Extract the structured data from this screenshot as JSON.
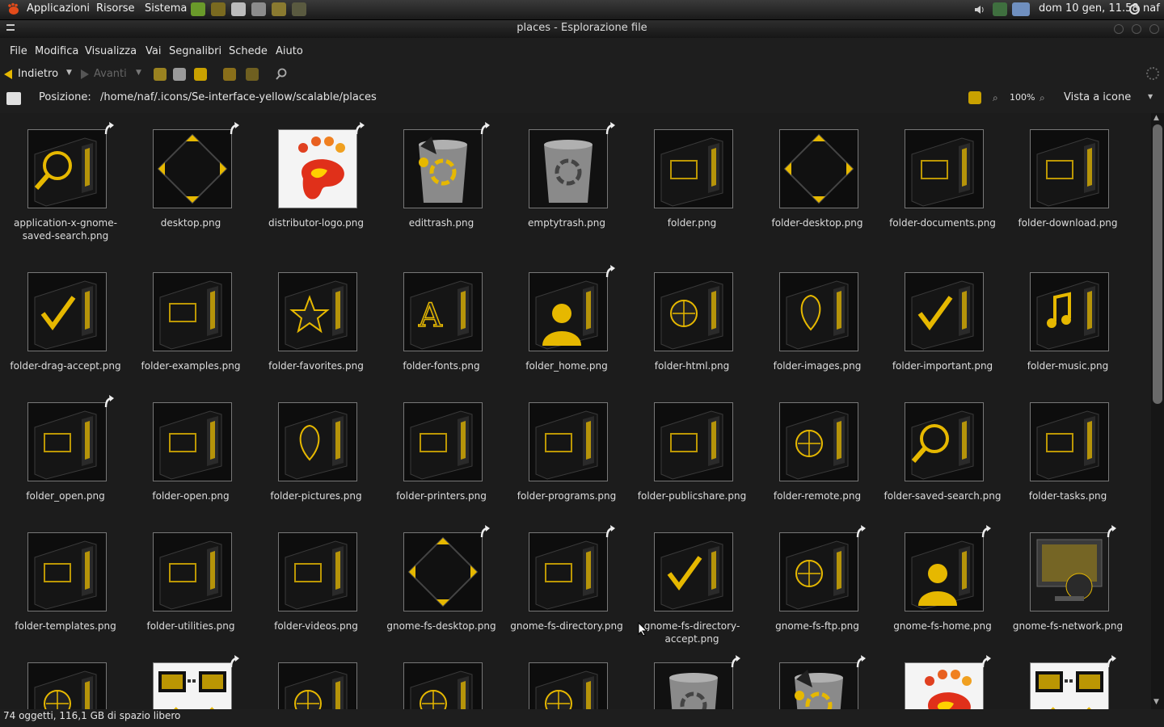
{
  "panel": {
    "menus": [
      "Applicazioni",
      "Risorse",
      "Sistema"
    ],
    "clock": "dom 10 gen, 11.58",
    "user": "naf"
  },
  "window": {
    "title": "places - Esplorazione file"
  },
  "menubar": [
    "File",
    "Modifica",
    "Visualizza",
    "Vai",
    "Segnalibri",
    "Schede",
    "Aiuto"
  ],
  "toolbar": {
    "back": "Indietro",
    "forward": "Avanti"
  },
  "location": {
    "label": "Posizione:",
    "path": "/home/naf/.icons/Se-interface-yellow/scalable/places",
    "zoom": "100%",
    "view_mode": "Vista a icone"
  },
  "colors": {
    "accent": "#e6b800",
    "background": "#1c1c1c",
    "frame": "#777777"
  },
  "files": [
    {
      "name": "application-x-gnome-saved-search.png",
      "icon": "folder-search-icon",
      "emblem": true
    },
    {
      "name": "desktop.png",
      "icon": "diamond-icon",
      "emblem": true
    },
    {
      "name": "distributor-logo.png",
      "icon": "gnome-foot-icon",
      "emblem": true
    },
    {
      "name": "edittrash.png",
      "icon": "trash-full-icon",
      "emblem": true
    },
    {
      "name": "emptytrash.png",
      "icon": "trash-empty-icon",
      "emblem": true
    },
    {
      "name": "folder.png",
      "icon": "folder-icon",
      "emblem": false
    },
    {
      "name": "folder-desktop.png",
      "icon": "diamond-icon",
      "emblem": false
    },
    {
      "name": "folder-documents.png",
      "icon": "folder-documents-icon",
      "emblem": false
    },
    {
      "name": "folder-download.png",
      "icon": "folder-download-icon",
      "emblem": false
    },
    {
      "name": "folder-drag-accept.png",
      "icon": "folder-check-icon",
      "emblem": false
    },
    {
      "name": "folder-examples.png",
      "icon": "folder-examples-icon",
      "emblem": false
    },
    {
      "name": "folder-favorites.png",
      "icon": "folder-star-icon",
      "emblem": false
    },
    {
      "name": "folder-fonts.png",
      "icon": "folder-fonts-icon",
      "emblem": false
    },
    {
      "name": "folder_home.png",
      "icon": "folder-home-icon",
      "emblem": true
    },
    {
      "name": "folder-html.png",
      "icon": "folder-globe-icon",
      "emblem": false
    },
    {
      "name": "folder-images.png",
      "icon": "folder-pictures-icon",
      "emblem": false
    },
    {
      "name": "folder-important.png",
      "icon": "folder-check-icon",
      "emblem": false
    },
    {
      "name": "folder-music.png",
      "icon": "folder-music-icon",
      "emblem": false
    },
    {
      "name": "folder_open.png",
      "icon": "folder-icon",
      "emblem": true
    },
    {
      "name": "folder-open.png",
      "icon": "folder-icon",
      "emblem": false
    },
    {
      "name": "folder-pictures.png",
      "icon": "folder-pictures-icon",
      "emblem": false
    },
    {
      "name": "folder-printers.png",
      "icon": "folder-printer-icon",
      "emblem": false
    },
    {
      "name": "folder-programs.png",
      "icon": "folder-programs-icon",
      "emblem": false
    },
    {
      "name": "folder-publicshare.png",
      "icon": "folder-users-icon",
      "emblem": false
    },
    {
      "name": "folder-remote.png",
      "icon": "folder-network-icon",
      "emblem": false
    },
    {
      "name": "folder-saved-search.png",
      "icon": "folder-search-icon",
      "emblem": false
    },
    {
      "name": "folder-tasks.png",
      "icon": "folder-tasks-icon",
      "emblem": false
    },
    {
      "name": "folder-templates.png",
      "icon": "folder-templates-icon",
      "emblem": false
    },
    {
      "name": "folder-utilities.png",
      "icon": "folder-utilities-icon",
      "emblem": false
    },
    {
      "name": "folder-videos.png",
      "icon": "folder-video-icon",
      "emblem": false
    },
    {
      "name": "gnome-fs-desktop.png",
      "icon": "diamond-icon",
      "emblem": true
    },
    {
      "name": "gnome-fs-directory.png",
      "icon": "folder-icon",
      "emblem": true
    },
    {
      "name": "gnome-fs-directory-accept.png",
      "icon": "folder-check-icon",
      "emblem": false
    },
    {
      "name": "gnome-fs-ftp.png",
      "icon": "folder-network-icon",
      "emblem": true
    },
    {
      "name": "gnome-fs-home.png",
      "icon": "folder-home-icon",
      "emblem": true
    },
    {
      "name": "gnome-fs-network.png",
      "icon": "network-monitor-icon",
      "emblem": true
    },
    {
      "name": "",
      "icon": "folder-network-icon",
      "emblem": false
    },
    {
      "name": "",
      "icon": "computers-icon",
      "emblem": true
    },
    {
      "name": "",
      "icon": "folder-network-icon",
      "emblem": false
    },
    {
      "name": "",
      "icon": "folder-network-icon",
      "emblem": false
    },
    {
      "name": "",
      "icon": "folder-network-icon",
      "emblem": false
    },
    {
      "name": "",
      "icon": "trash-empty-icon",
      "emblem": true
    },
    {
      "name": "",
      "icon": "trash-full-icon",
      "emblem": true
    },
    {
      "name": "",
      "icon": "gnome-foot-icon",
      "emblem": true
    },
    {
      "name": "",
      "icon": "computers-icon",
      "emblem": true
    }
  ],
  "status": "74 oggetti, 116,1 GB di spazio libero"
}
